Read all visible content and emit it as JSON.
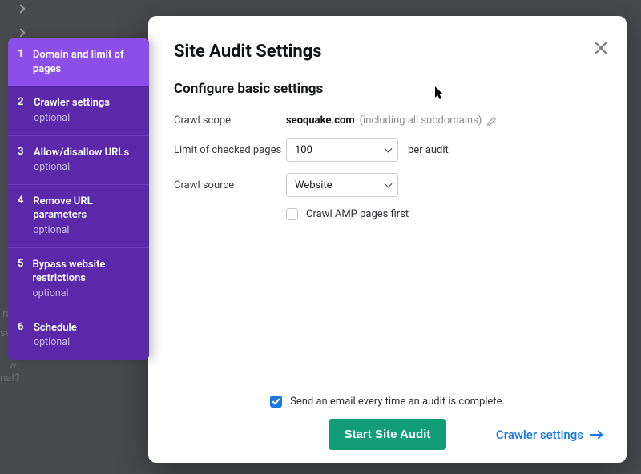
{
  "modal": {
    "title": "Site Audit Settings",
    "subtitle": "Configure basic settings",
    "crawl_scope_label": "Crawl scope",
    "crawl_scope_domain": "seoquake.com",
    "crawl_scope_note": "(including all subdomains)",
    "limit_label": "Limit of checked pages",
    "limit_value": "100",
    "limit_suffix": "per audit",
    "source_label": "Crawl source",
    "source_value": "Website",
    "amp_checkbox_label": "Crawl AMP pages first",
    "email_checkbox_label": "Send an email every time an audit is complete.",
    "primary_button": "Start Site Audit",
    "secondary_link": "Crawler settings"
  },
  "stepper": [
    {
      "num": "1",
      "title": "Domain and limit of pages",
      "optional": ""
    },
    {
      "num": "2",
      "title": "Crawler settings",
      "optional": "optional"
    },
    {
      "num": "3",
      "title": "Allow/disallow URLs",
      "optional": "optional"
    },
    {
      "num": "4",
      "title": "Remove URL parameters",
      "optional": "optional"
    },
    {
      "num": "5",
      "title": "Bypass website restrictions",
      "optional": "optional"
    },
    {
      "num": "6",
      "title": "Schedule",
      "optional": "optional"
    }
  ],
  "background_fragments": {
    "a": "ram",
    "b": "se or",
    "c": "w",
    "d": "nat?"
  }
}
